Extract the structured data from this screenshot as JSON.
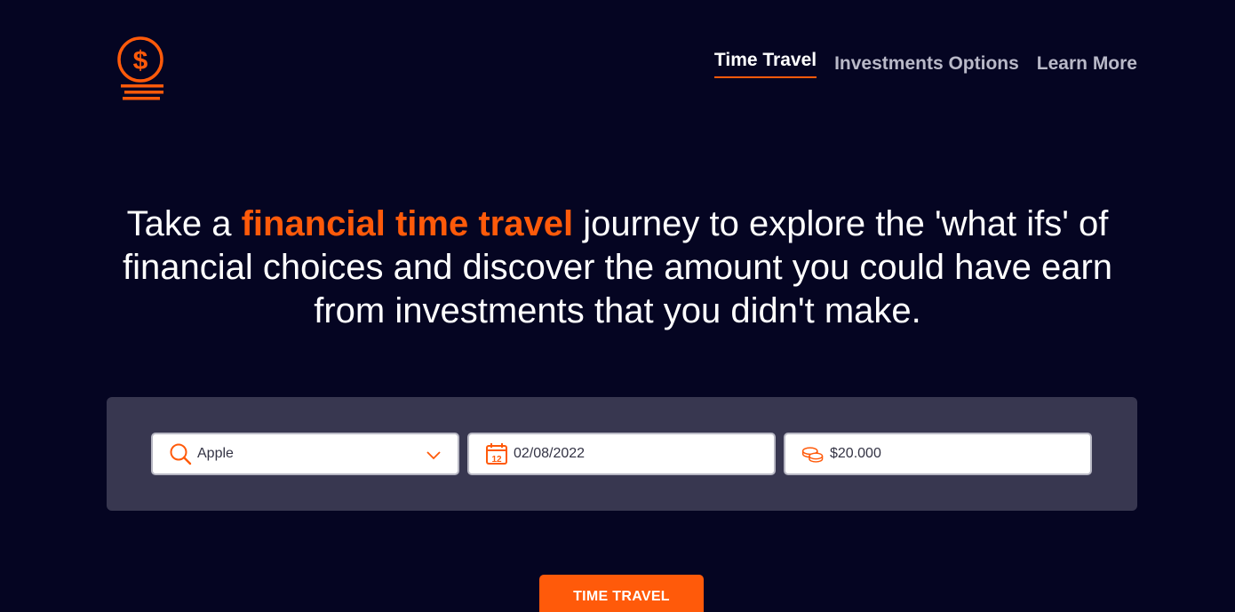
{
  "nav": {
    "items": [
      {
        "label": "Time Travel",
        "active": true
      },
      {
        "label": "Investments Options",
        "active": false
      },
      {
        "label": "Learn More",
        "active": false
      }
    ]
  },
  "hero": {
    "prefix": "Take a ",
    "highlight": "financial time travel",
    "suffix": " journey to explore the 'what ifs' of financial choices and discover the amount you could have earn from investments that you didn't make."
  },
  "form": {
    "asset": {
      "value": "Apple",
      "icon": "search-icon"
    },
    "date": {
      "value": "02/08/2022",
      "icon": "calendar-icon",
      "icon_day": "12"
    },
    "amount": {
      "value": "$20.000",
      "icon": "coins-icon"
    }
  },
  "cta": {
    "label": "TIME TRAVEL"
  },
  "colors": {
    "accent": "#ff5a0a",
    "background": "#050522",
    "panel": "#383750"
  }
}
